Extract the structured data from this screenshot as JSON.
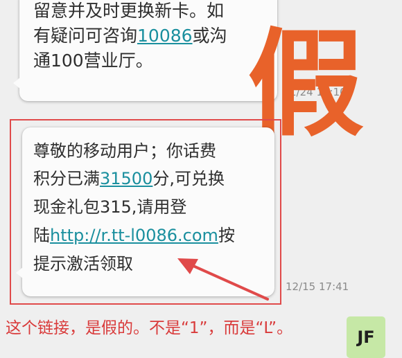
{
  "top_message": {
    "lines": [
      "留意并及时更换新卡。如",
      "有疑问可咨询",
      "10086",
      "或沟",
      "通100营业厅。"
    ],
    "timestamp": "1/24 12:10"
  },
  "annotation": {
    "fake_char": "假",
    "caption": "这个链接，是假的。不是“1”，而是“L”。"
  },
  "main_message": {
    "line1": "尊敬的移动用户；你话费",
    "line2_pre": "积分已满",
    "line2_link": "31500",
    "line2_post": "分,可兑换",
    "line3": "现金礼包315,请用登",
    "line4_pre": "陆",
    "line4_link": "http://r.tt-l0086.com",
    "line4_post": "按",
    "line5": "提示激活领取",
    "timestamp": "12/15 17:41"
  },
  "right_bubble": {
    "text": "JF"
  },
  "colors": {
    "link": "#1a8f9e",
    "annotation": "#d93a3a",
    "fake_char": "#e8622a",
    "reply_bubble": "#c6e8a6"
  }
}
